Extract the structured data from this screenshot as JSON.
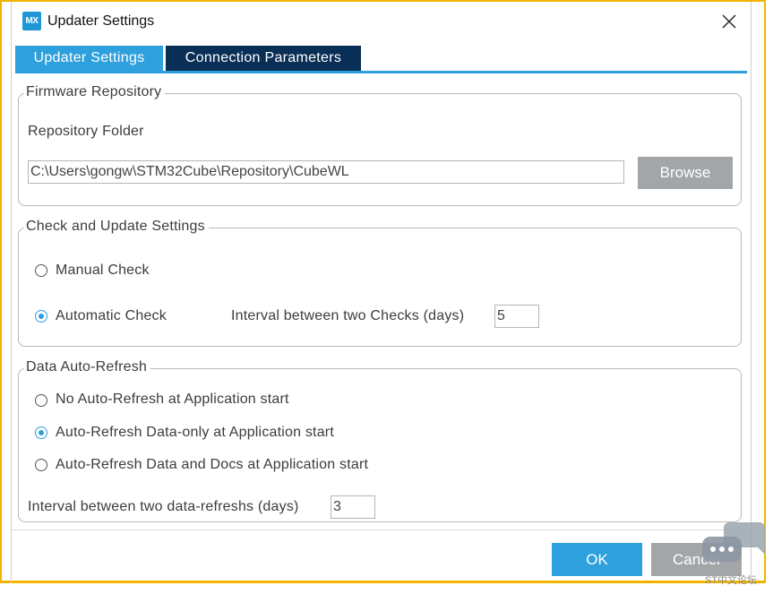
{
  "window": {
    "app_icon_text": "MX",
    "title": "Updater Settings"
  },
  "tabs": [
    {
      "label": "Updater Settings",
      "active": true
    },
    {
      "label": "Connection Parameters",
      "active": false
    }
  ],
  "firmware_repository": {
    "legend": "Firmware Repository",
    "folder_label": "Repository Folder",
    "folder_value": "C:\\Users\\gongw\\STM32Cube\\Repository\\CubeWL",
    "browse_label": "Browse"
  },
  "check_update": {
    "legend": "Check and Update Settings",
    "manual_label": "Manual Check",
    "automatic_label": "Automatic Check",
    "selected": "automatic",
    "interval_label": "Interval between two Checks (days)",
    "interval_value": "5"
  },
  "auto_refresh": {
    "legend": "Data Auto-Refresh",
    "options": [
      {
        "label": "No Auto-Refresh at Application start",
        "checked": false
      },
      {
        "label": "Auto-Refresh Data-only at Application start",
        "checked": true
      },
      {
        "label": "Auto-Refresh Data and Docs at Application start",
        "checked": false
      }
    ],
    "interval_label": "Interval between two data-refreshs (days)",
    "interval_value": "3"
  },
  "footer": {
    "ok_label": "OK",
    "cancel_label": "Cancel"
  },
  "watermark": {
    "text": "ST中文论坛"
  },
  "colors": {
    "accent": "#2ea0dd",
    "tab_inactive": "#0a2f56",
    "button_gray": "#a2a6a9",
    "highlight_frame": "#f0b400"
  }
}
